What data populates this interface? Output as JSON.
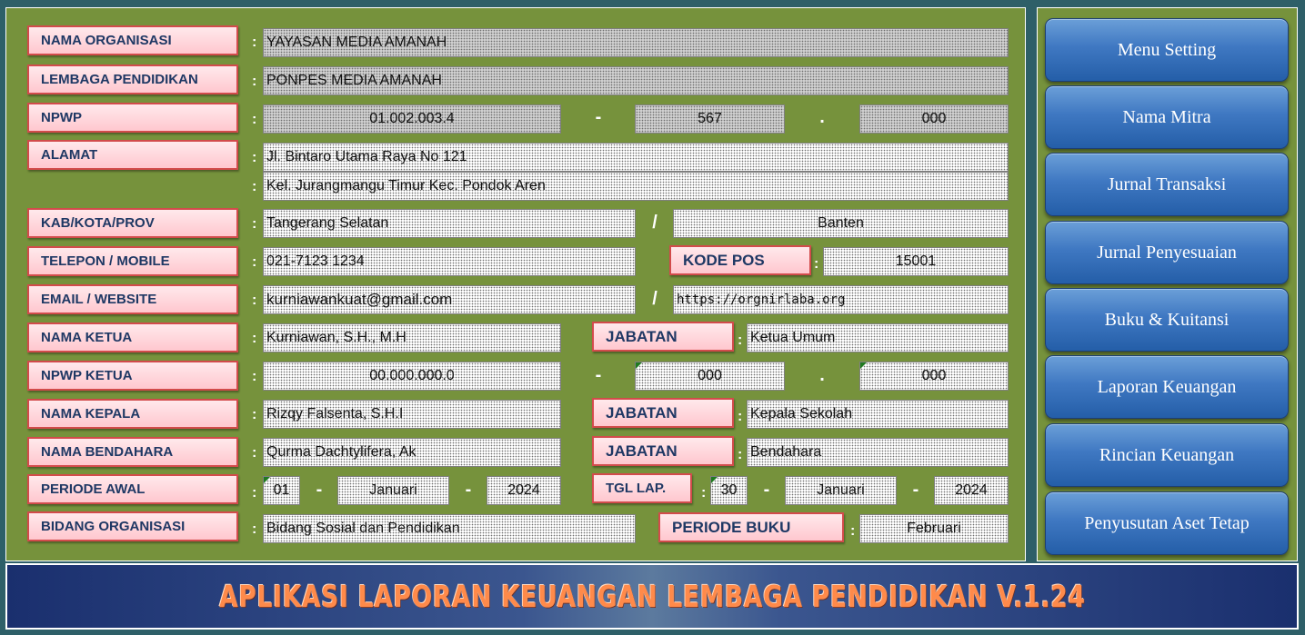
{
  "form": {
    "labels": {
      "nama_organisasi": "NAMA ORGANISASI",
      "lembaga_pendidikan": "LEMBAGA PENDIDIKAN",
      "npwp": "NPWP",
      "alamat": "ALAMAT",
      "kab_kota_prov": "KAB/KOTA/PROV",
      "telepon_mobile": "TELEPON / MOBILE",
      "email_website": "EMAIL / WEBSITE",
      "nama_ketua": "NAMA KETUA",
      "npwp_ketua": "NPWP KETUA",
      "nama_kepala": "NAMA KEPALA",
      "nama_bendahara": "NAMA BENDAHARA",
      "periode_awal": "PERIODE AWAL",
      "bidang_organisasi": "BIDANG ORGANISASI",
      "kode_pos": "KODE POS",
      "jabatan": "JABATAN",
      "tgl_lap": "TGL LAP.",
      "periode_buku": "PERIODE BUKU"
    },
    "values": {
      "nama_organisasi": "YAYASAN MEDIA AMANAH",
      "lembaga_pendidikan": "PONPES MEDIA AMANAH",
      "npwp_1": "01.002.003.4",
      "npwp_2": "567",
      "npwp_3": "000",
      "alamat_1": "Jl. Bintaro Utama Raya No 121",
      "alamat_2": "Kel. Jurangmangu Timur Kec. Pondok Aren",
      "kab_kota": "Tangerang Selatan",
      "provinsi": "Banten",
      "telepon": "021-7123 1234",
      "kode_pos": "15001",
      "email": "kurniawankuat@gmail.com",
      "website": "https://orgnirlaba.org",
      "nama_ketua": "Kurniawan, S.H., M.H",
      "jabatan_ketua": "Ketua Umum",
      "npwp_ketua_1": "00.000.000.0",
      "npwp_ketua_2": "000",
      "npwp_ketua_3": "000",
      "nama_kepala": "Rizqy Falsenta, S.H.I",
      "jabatan_kepala": "Kepala Sekolah",
      "nama_bendahara": "Qurma Dachtylifera, Ak",
      "jabatan_bendahara": "Bendahara",
      "periode_awal_tgl": "01",
      "periode_awal_bulan": "Januari",
      "periode_awal_tahun": "2024",
      "tgl_lap_tgl": "30",
      "tgl_lap_bulan": "Januari",
      "tgl_lap_tahun": "2024",
      "bidang_organisasi": "Bidang Sosial dan Pendidikan",
      "periode_buku": "Februari"
    },
    "colon": ":",
    "sep_slash": "/",
    "sep_dash": "-",
    "sep_dot": "."
  },
  "menu": [
    "Menu Setting",
    "Nama Mitra",
    "Jurnal Transaksi",
    "Jurnal Penyesuaian",
    "Buku & Kuitansi",
    "Laporan Keuangan",
    "Rincian Keuangan",
    "Penyusutan Aset Tetap"
  ],
  "banner": {
    "title": "APLIKASI LAPORAN KEUANGAN LEMBAGA PENDIDIKAN V.1.24"
  },
  "colors": {
    "panel": "#76923c",
    "background": "#2e5f68",
    "label_fill": "#ffc7cf",
    "label_text": "#1f3864",
    "button": "#3f78c2",
    "banner_text": "#ff8a4a"
  }
}
